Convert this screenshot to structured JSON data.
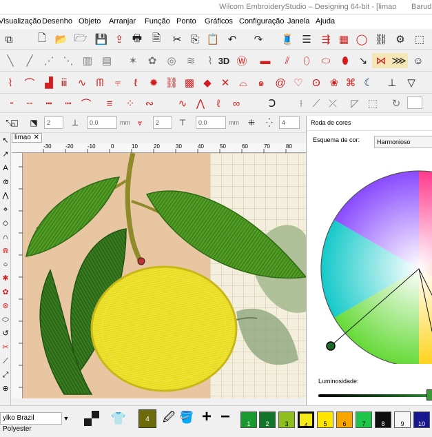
{
  "window": {
    "title": "Wilcom EmbroideryStudio – Designing 64-bit - [limao",
    "user_fragment": "Baruda"
  },
  "menu": [
    "Visualização",
    "Desenho",
    "Objeto",
    "Arranjar",
    "Função",
    "Ponto",
    "Gráficos",
    "Configuração",
    "Janela",
    "Ajuda"
  ],
  "toolbar": {
    "label_3d": "3D",
    "fields": [
      "2",
      "0.0",
      "mm",
      "2",
      "0.0",
      "mm",
      "4"
    ]
  },
  "document": {
    "tab_label": "limao",
    "ruler_labels": [
      "-30",
      "-20",
      "-10",
      "0",
      "10",
      "20",
      "30",
      "40",
      "50",
      "60",
      "70",
      "80",
      "90"
    ]
  },
  "color_wheel": {
    "panel_title": "Roda de cores",
    "scheme_label": "Esquema de cor:",
    "scheme_value": "Harmonioso",
    "brightness_label": "Luminosidade:"
  },
  "status": {
    "thread_chart": "ylko Brazil Polyester",
    "current_color_number": "4",
    "palette": [
      {
        "n": "1",
        "color": "#1a9a2e"
      },
      {
        "n": "2",
        "color": "#13752a"
      },
      {
        "n": "3",
        "color": "#8fbe1f"
      },
      {
        "n": "4",
        "color": "#f4ea18"
      },
      {
        "n": "5",
        "color": "#ffe600"
      },
      {
        "n": "6",
        "color": "#f7a600"
      },
      {
        "n": "7",
        "color": "#1fc44a"
      },
      {
        "n": "8",
        "color": "#0e0e0e"
      },
      {
        "n": "9",
        "color": "#f6f6f6"
      },
      {
        "n": "10",
        "color": "#17178f"
      }
    ]
  },
  "accent_colors": {
    "selected_swatch": "#6b6b0c",
    "wheel_marker": "#1c6b2a"
  }
}
